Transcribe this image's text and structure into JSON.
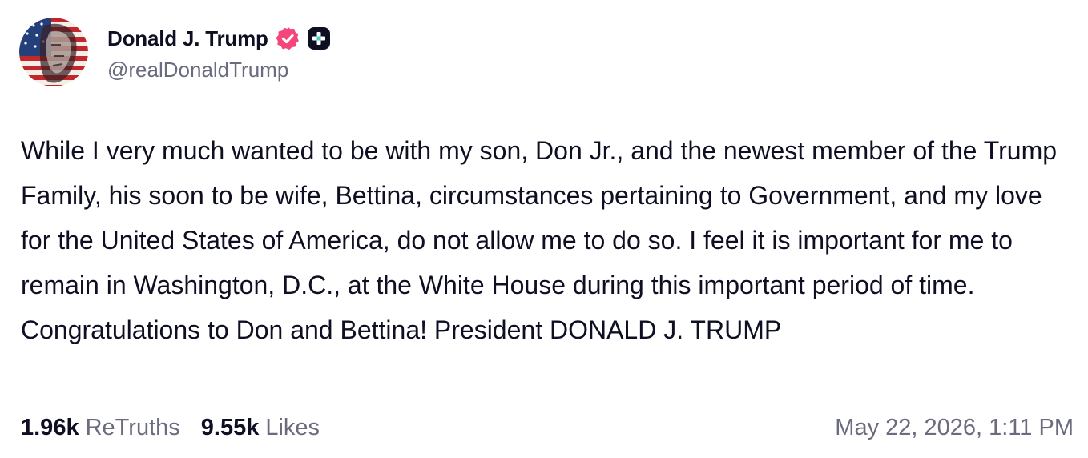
{
  "post": {
    "author": {
      "display_name": "Donald J. Trump",
      "handle": "@realDonaldTrump",
      "verified_icon": "verified-badge-icon",
      "plus_icon": "plus-badge-icon",
      "verified_color": "#f4467a"
    },
    "text": "While I very much wanted to be with my son, Don Jr., and the newest member of the Trump Family, his soon to be wife, Bettina, circumstances pertaining to Government, and my love for the United States of America, do not allow me to do so. I feel it is important for me to remain in Washington, D.C., at the White House during this important period of time. Congratulations to Don and Bettina! President DONALD J. TRUMP",
    "stats": {
      "retruths_count": "1.96k",
      "retruths_label": "ReTruths",
      "likes_count": "9.55k",
      "likes_label": "Likes"
    },
    "timestamp": "May 22, 2026, 1:11 PM"
  },
  "colors": {
    "text": "#0f0f23",
    "muted": "#6b6b80",
    "background": "#ffffff"
  }
}
